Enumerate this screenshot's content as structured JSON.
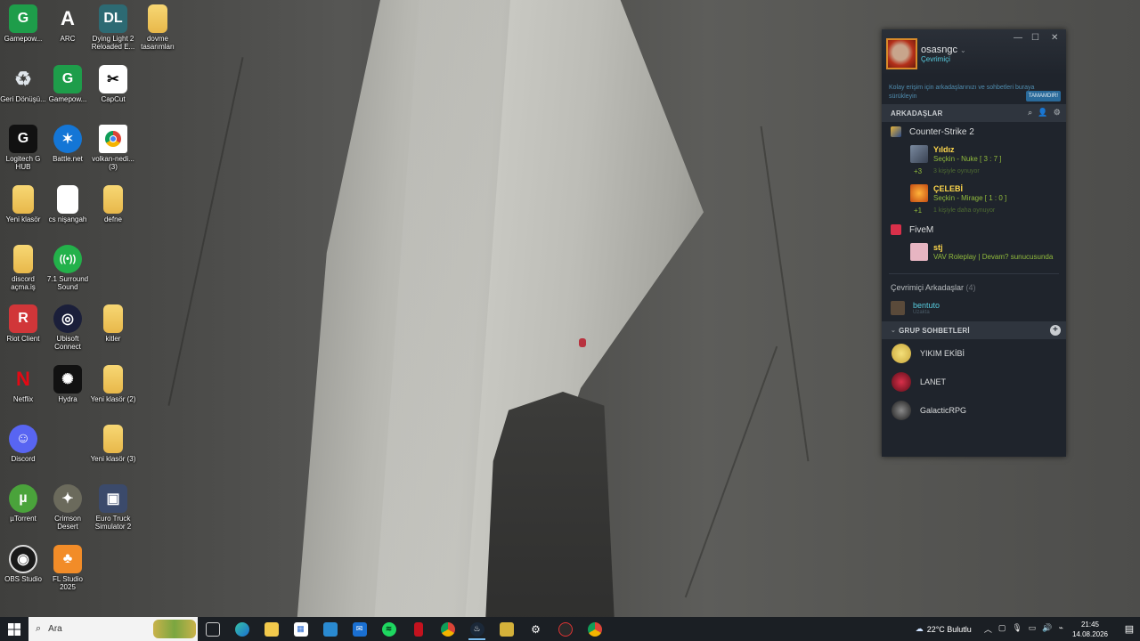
{
  "desktop": {
    "icons": [
      {
        "label": "Gamepow...",
        "icon": "gamepower-icon",
        "color": "#1e9d4a"
      },
      {
        "label": "ARC",
        "icon": "arc-icon",
        "color": "#e8e8e8"
      },
      {
        "label": "Dying Light 2 Reloaded E...",
        "icon": "dying-light-icon",
        "color": "#2d6a73"
      },
      {
        "label": "dovme tasarımları",
        "icon": "folder-icon",
        "color": "#f2c94c"
      },
      {
        "label": "Geri Dönüşü...",
        "icon": "recycle-bin-icon",
        "color": "#cfd6dc"
      },
      {
        "label": "Gamepow...",
        "icon": "gamepower-icon",
        "color": "#1e9d4a"
      },
      {
        "label": "CapCut",
        "icon": "capcut-icon",
        "color": "#111111"
      },
      {
        "label": "Logitech G HUB",
        "icon": "logitech-icon",
        "color": "#111111"
      },
      {
        "label": "Battle.net",
        "icon": "battlenet-icon",
        "color": "#1476d6"
      },
      {
        "label": "volkan-nedi... (3)",
        "icon": "chrome-icon",
        "color": "#ffffff"
      },
      {
        "label": "Yeni klasör",
        "icon": "folder-icon",
        "color": "#f2c94c"
      },
      {
        "label": "cs nişangah",
        "icon": "document-icon",
        "color": "#ffffff"
      },
      {
        "label": "defne",
        "icon": "folder-icon",
        "color": "#f2c94c"
      },
      {
        "label": "discord açma.iş",
        "icon": "folder-icon",
        "color": "#f2c94c"
      },
      {
        "label": "7.1 Surround Sound",
        "icon": "surround-icon",
        "color": "#23b14a"
      },
      {
        "label": "Riot Client",
        "icon": "riot-icon",
        "color": "#d13639"
      },
      {
        "label": "Ubisoft Connect",
        "icon": "ubisoft-icon",
        "color": "#1b1f3a"
      },
      {
        "label": "kitler",
        "icon": "folder-icon",
        "color": "#f2c94c"
      },
      {
        "label": "Netflix",
        "icon": "netflix-icon",
        "color": "#111111"
      },
      {
        "label": "Hydra",
        "icon": "hydra-icon",
        "color": "#f2f2f2"
      },
      {
        "label": "Yeni klasör (2)",
        "icon": "folder-icon",
        "color": "#f2c94c"
      },
      {
        "label": "Discord",
        "icon": "discord-icon",
        "color": "#5865f2"
      },
      {
        "label": "Yeni klasör (3)",
        "icon": "folder-icon",
        "color": "#f2c94c"
      },
      {
        "label": "µTorrent",
        "icon": "utorrent-icon",
        "color": "#4aa33b"
      },
      {
        "label": "Crimson Desert",
        "icon": "crimson-desert-icon",
        "color": "#6b6a5c"
      },
      {
        "label": "Euro Truck Simulator 2",
        "icon": "ets2-icon",
        "color": "#3b4a6b"
      },
      {
        "label": "OBS Studio",
        "icon": "obs-icon",
        "color": "#1a1a1a"
      },
      {
        "label": "FL Studio 2025",
        "icon": "flstudio-icon",
        "color": "#f28c28"
      }
    ]
  },
  "steam": {
    "username": "osasngc",
    "status": "Çevrimiçi",
    "tip": "Kolay erişim için arkadaşlarınızı ve sohbetleri buraya sürükleyin",
    "tip_button": "TAMAMDIR!",
    "friends_header": "ARKADAŞLAR",
    "games": [
      {
        "name": "Counter-Strike 2",
        "friends": [
          {
            "name": "Yıldız",
            "game": "Seçkin - Nuke [ 3 : 7 ]",
            "count": "+3",
            "extra": "3 kişiyle oynuyor"
          },
          {
            "name": "ÇELEBİ",
            "game": "Seçkin - Mirage [ 1 : 0 ]",
            "count": "+1",
            "extra": "1 kişiyle daha oynuyor"
          }
        ]
      },
      {
        "name": "FiveM",
        "friends": [
          {
            "name": "stj",
            "game": "VAV Roleplay | Devam? sunucusunda"
          }
        ]
      }
    ],
    "online_header": "Çevrimiçi Arkadaşlar",
    "online_count": "(4)",
    "online_friend": "bentuto",
    "online_friend_sub": "Uzakta",
    "groups_header": "GRUP SOHBETLERİ",
    "groups": [
      "YIKIM EKİBİ",
      "LANET",
      "GalacticRPG"
    ]
  },
  "taskbar": {
    "search_placeholder": "Ara",
    "weather": "22°C Bulutlu",
    "time": "21:45",
    "date": "14.08.2026",
    "apps": [
      "task-view",
      "edge",
      "file-explorer",
      "store",
      "app-blue",
      "mail",
      "spotify",
      "red-app",
      "chrome",
      "steam",
      "arc-app",
      "settings",
      "app-dark",
      "chrome-2"
    ]
  }
}
